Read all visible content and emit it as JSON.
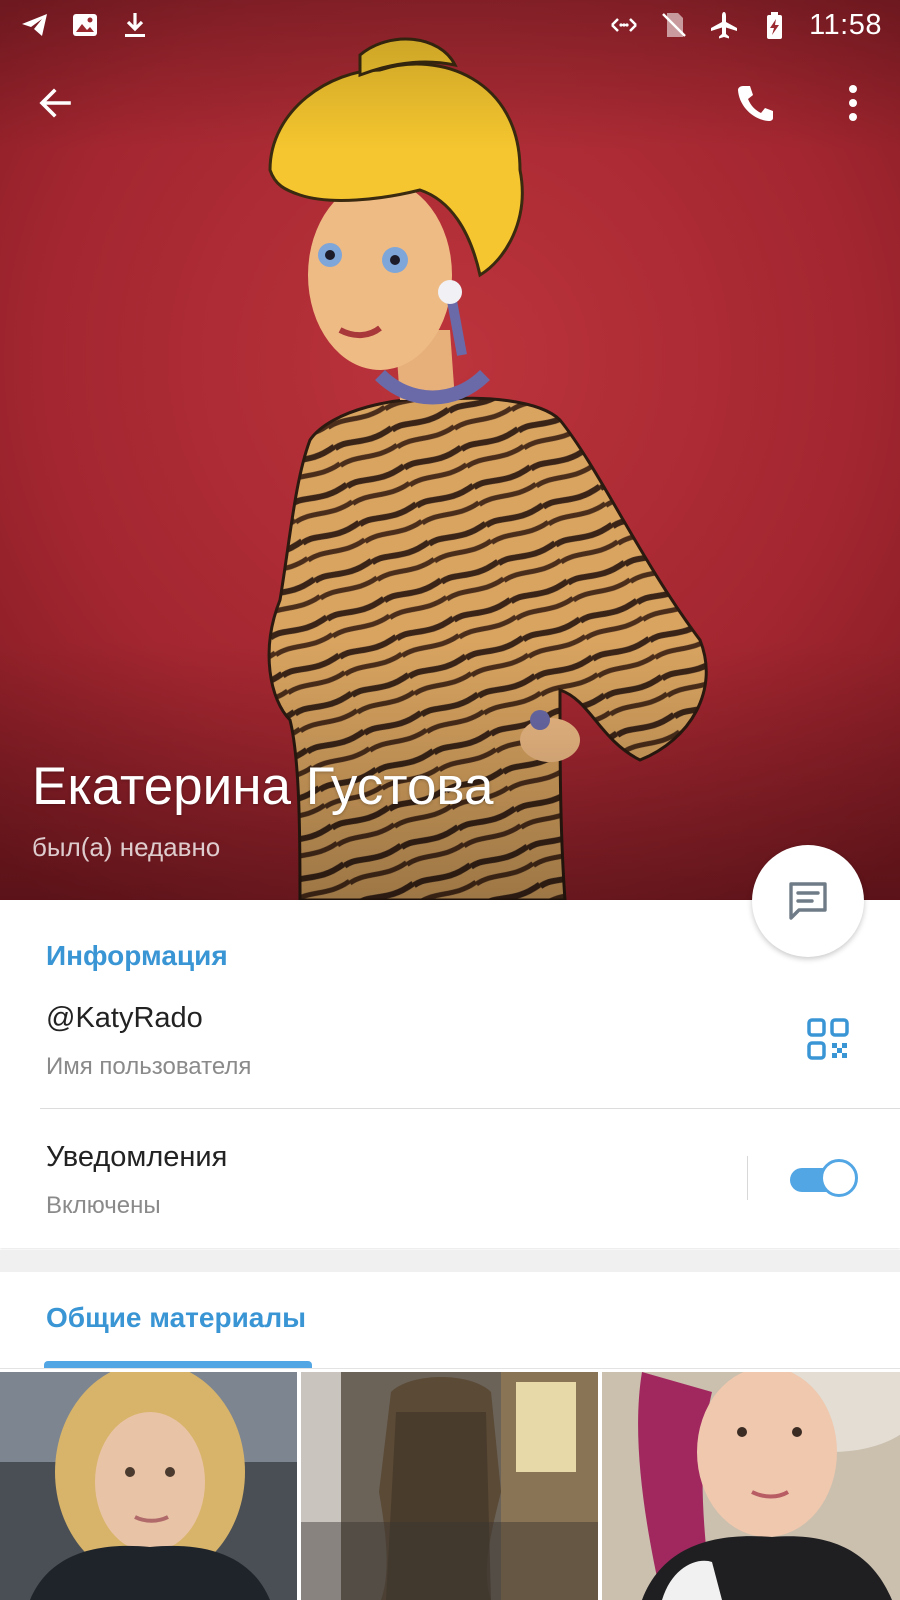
{
  "status_bar": {
    "time": "11:58",
    "left_icons": [
      "telegram-icon",
      "image-icon",
      "download-icon"
    ],
    "right_icons": [
      "data-arrows-icon",
      "no-sim-icon",
      "airplane-mode-icon",
      "battery-charging-icon"
    ]
  },
  "toolbar": {
    "back_icon": "arrow-left-icon",
    "call_icon": "phone-icon",
    "more_icon": "more-vertical-icon"
  },
  "profile": {
    "name": "Екатерина Густова",
    "status": "был(а) недавно"
  },
  "fab": {
    "icon": "message-icon"
  },
  "info": {
    "title": "Информация",
    "username": {
      "value": "@KatyRado",
      "label": "Имя пользователя",
      "icon": "qr-code-icon"
    },
    "notifications": {
      "value": "Уведомления",
      "label": "Включены",
      "enabled": true
    }
  },
  "shared_media": {
    "title": "Общие материалы",
    "thumbnails": [
      "photo-thumbnail-1",
      "photo-thumbnail-2",
      "photo-thumbnail-3"
    ]
  },
  "colors": {
    "accent": "#3a95d5",
    "toggle_on": "#52a6e4",
    "hero_background": "#a5262f"
  }
}
